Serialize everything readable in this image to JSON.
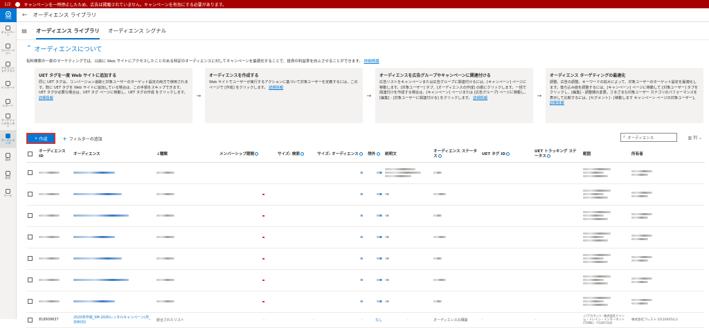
{
  "alert": {
    "counter": "1/2",
    "message": "キャンペーンを一時停止したため、広告は掲載されていません。キャンペーンを有効にする必要があります。"
  },
  "rail": {
    "create_label": "作成",
    "items": [
      {
        "label": "キャンペーン",
        "icon": "campaign-icon"
      },
      {
        "label": "コンバージョン",
        "icon": "conversion-icon"
      },
      {
        "label": "アカウントライブラリ",
        "icon": "library-icon"
      },
      {
        "label": "インポート",
        "icon": "import-icon"
      },
      {
        "label": "レポート",
        "icon": "report-icon"
      },
      {
        "label": "マーケティングセンター",
        "icon": "marketing-icon"
      },
      {
        "label": "オーディエンス",
        "icon": "audience-icon"
      },
      {
        "label": "請求",
        "icon": "billing-icon"
      },
      {
        "label": "設定",
        "icon": "gear-icon"
      },
      {
        "label": "ツール",
        "icon": "tools-icon"
      }
    ]
  },
  "header": {
    "title": "オーディエンス ライブラリ"
  },
  "tabs": [
    {
      "label": "オーディエンス ライブラリ",
      "selected": true
    },
    {
      "label": "オーディエンス シグナル",
      "selected": false
    }
  ],
  "about": {
    "title": "オーディエンスについて",
    "description": "有料検索の一部のマーケティングでは、以前に Web サイトにアクセスしたことのある特定のオーディエンスに対してキャンペーンを最適化することで、投資の利益率を向上させることができます。",
    "more": "詳細情報"
  },
  "cards": [
    {
      "title": "UET タグを一度 Web サイトに追加する",
      "body": "同じ UET タグは、コンバージョン追跡と対象ユーザーのターゲット設定の両方で使用されます。既に UET タグを Web サイトに追加している場合は、この手順をスキップできます。UET タグが必要な場合は、UET タグ ページに移動し、UET タグの作成 をクリックします。",
      "more": "詳細情報"
    },
    {
      "title": "オーディエンスを作成する",
      "body": "Web サイトでユーザーが実行するアクションに基づいて対象ユーザーを定義するには、このページで [作成] をクリックします。",
      "more": "詳細情報"
    },
    {
      "title": "オーディエンスを広告グループやキャンペーンに関連付ける",
      "body": "広告リストをキャンペーンまたは広告グループに関連付けるには、[キャンペーン] ページに移動します。[対象ユーザー] タブ、[オーディエンスの作成] の順にクリックします。一括で関連付けを作成する場合は、[キャンペーン] ページまたは [広告グループ] ページに移動し、[編集] - [対象ユーザーに関連付ける] をクリックします。",
      "more": "詳細情報"
    },
    {
      "title": "オーディエンス ターゲティングの最適化",
      "body": "調整、広告の調整、キーワードの拡大によって、対象ユーザーのターゲット設定を最適化します。落ち込み値を調整するには、[キャンペーン] ページに移動して [対象ユーザー] タブをクリックし、[編集] - 調整額の変更。さまざまな対象ユーザー カテゴリのパフォーマンスを表示して比較するには、[セグメント] - [移動します キャンペーン ページの対象ユーザー]。",
      "more": "詳細情報"
    }
  ],
  "toolbar": {
    "create_label": "作成",
    "filter_label": "フィルターの追加",
    "search_placeholder": "オーディエンス",
    "columns_label": "列"
  },
  "table": {
    "columns": [
      "オーディエンス ID",
      "オーディエンス",
      "↓種類",
      "メンバーシップ期間",
      "サイズ: 検索",
      "サイズ: オーディエンス",
      "除外",
      "説明文",
      "オーディエンス ステータス",
      "UET タグ ID",
      "UET トラッキング ステータス",
      "範囲",
      "所有者"
    ],
    "last_row": {
      "id": "818909637",
      "name": "2020年作成_SM-2020レンタルキャンペーン(月_日80日)",
      "type": "結合されたリスト",
      "membership": "-",
      "size_search": "-",
      "size_audience": "-",
      "exclusion": "なし",
      "description": "-",
      "status": "オーディエンスの構築",
      "uet_id": "-",
      "uet_status": "-",
      "scope": "ノ/アカウント: 株式会社ドリーム・トレイン・インターネット (TDNE) - F12873(Q)",
      "owner": "株式会社フレスト (0120005(L))"
    }
  },
  "colors": {
    "accent": "#0078d4",
    "alert": "#a80000",
    "highlight": "#d13438"
  }
}
